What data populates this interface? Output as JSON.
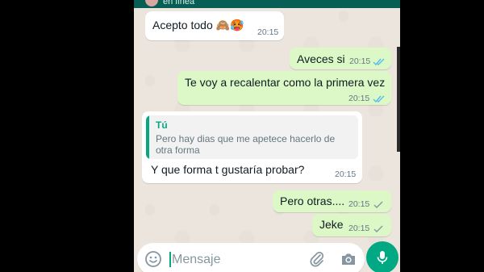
{
  "colors": {
    "background": "#ece5dd",
    "incoming_bubble": "#ffffff",
    "outgoing_bubble": "#dcf8c6",
    "accent": "#00a884",
    "read_tick": "#53bdeb",
    "sent_tick": "#8696a0"
  },
  "header": {
    "status": "en línea"
  },
  "messages": [
    {
      "direction": "incoming",
      "text": "Acepto todo 🙈🥵",
      "time": "20:15"
    },
    {
      "direction": "outgoing",
      "text": "Aveces si",
      "time": "20:15",
      "status_icon": "double-check-read-icon"
    },
    {
      "direction": "outgoing",
      "text": "Te voy a recalentar como la primera vez",
      "time": "20:15",
      "status_icon": "double-check-read-icon"
    },
    {
      "direction": "incoming",
      "reply": {
        "author": "Tú",
        "quote": "Pero hay dias que me apetece hacerlo de otra forma"
      },
      "text": "Y que forma t gustaría probar?",
      "time": "20:15"
    },
    {
      "direction": "outgoing",
      "text": "Pero otras....",
      "time": "20:15",
      "status_icon": "single-check-icon"
    },
    {
      "direction": "outgoing",
      "text": "Jeke",
      "time": "20:15",
      "status_icon": "single-check-icon"
    }
  ],
  "composer": {
    "placeholder": "Mensaje",
    "icons": [
      "emoji-icon",
      "paperclip-icon",
      "camera-icon",
      "microphone-icon"
    ]
  }
}
